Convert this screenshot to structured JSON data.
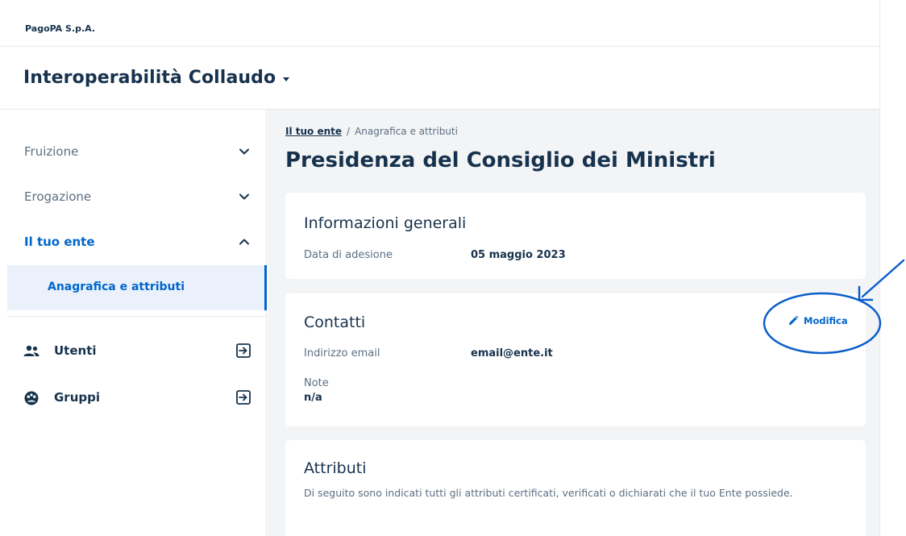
{
  "header": {
    "company": "PagoPA S.p.A.",
    "product": "Interoperabilità Collaudo"
  },
  "sidebar": {
    "sections": [
      {
        "label": "Fruizione",
        "expanded": false
      },
      {
        "label": "Erogazione",
        "expanded": false
      },
      {
        "label": "Il tuo ente",
        "expanded": true,
        "active": true
      }
    ],
    "sub_items": [
      {
        "label": "Anagrafica e attributi",
        "selected": true
      }
    ],
    "links": [
      {
        "label": "Utenti",
        "icon": "people-icon"
      },
      {
        "label": "Gruppi",
        "icon": "groups-icon"
      }
    ]
  },
  "breadcrumb": {
    "parent": "Il tuo ente",
    "separator": "/",
    "current": "Anagrafica e attributi"
  },
  "page": {
    "title": "Presidenza del Consiglio dei Ministri"
  },
  "general_info": {
    "title": "Informazioni generali",
    "join_date_label": "Data di adesione",
    "join_date_value": "05 maggio 2023"
  },
  "contacts": {
    "title": "Contatti",
    "edit_label": "Modifica",
    "email_label": "Indirizzo email",
    "email_value": "email@ente.it",
    "note_label": "Note",
    "note_value": "n/a"
  },
  "attributes": {
    "title": "Attributi",
    "description": "Di seguito sono indicati tutti gli attributi certificati, verificati o dichiarati che il tuo Ente possiede."
  },
  "colors": {
    "primary": "#0066cc",
    "text": "#17324d",
    "muted": "#5c6f82",
    "background": "#f2f4f6",
    "annotation": "#0b5fc9"
  }
}
